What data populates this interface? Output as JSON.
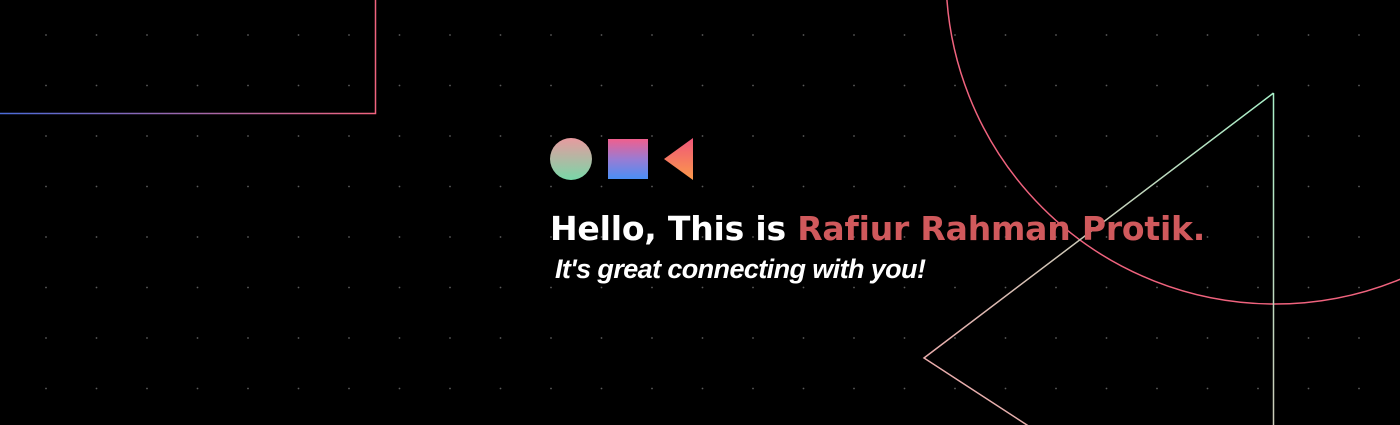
{
  "banner": {
    "greeting": "Hello, This is ",
    "name": "Rafiur Rahman Protik.",
    "tagline": "It's great connecting with you!"
  },
  "decor": {
    "icons": [
      "circle-icon",
      "square-icon",
      "triangle-icon"
    ],
    "colors": {
      "background": "#000000",
      "name_accent": "#d0595c",
      "circle_gradient": [
        "#e89a9f",
        "#78d8a8"
      ],
      "square_gradient": [
        "#f05f8e",
        "#4a8ff5"
      ],
      "triangle_gradient": [
        "#f0567a",
        "#fb9a4a"
      ],
      "outline_gradient": [
        "#4a6bd8",
        "#f0637e"
      ],
      "big_triangle_gradient": [
        "#f2a3a8",
        "#a8f0c8"
      ],
      "big_circle_color": "#f0637e",
      "dots": "#5a5a5a"
    }
  }
}
